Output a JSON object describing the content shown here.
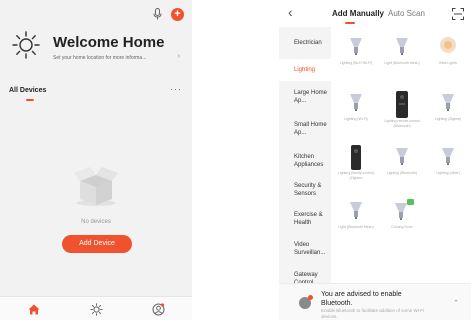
{
  "left": {
    "status_text": "",
    "welcome": {
      "title": "Welcome Home",
      "subtitle": "Set your home location for more informa...",
      "arrow": "›"
    },
    "devices": {
      "tab_label": "All Devices",
      "more": "···"
    },
    "empty": {
      "text": "No devices",
      "button": "Add Device"
    },
    "nav": [
      {
        "icon": "home-icon",
        "active": true
      },
      {
        "icon": "scene-icon",
        "active": false
      },
      {
        "icon": "profile-icon",
        "active": false
      }
    ],
    "accent_color": "#f0522d"
  },
  "right": {
    "back": "‹",
    "tabs": {
      "manual": "Add Manually",
      "scan": "Auto Scan"
    },
    "categories": [
      {
        "label": "Electrician",
        "active": false
      },
      {
        "label": "Lighting",
        "active": true
      },
      {
        "label": "Large Home Ap...",
        "active": false
      },
      {
        "label": "Small Home Ap...",
        "active": false
      },
      {
        "label": "Kitchen Appliances",
        "active": false
      },
      {
        "label": "Security & Sensors",
        "active": false
      },
      {
        "label": "Exercise & Health",
        "active": false
      },
      {
        "label": "Video Surveillan...",
        "active": false
      },
      {
        "label": "Gateway Control",
        "active": false
      }
    ],
    "products": [
      {
        "label": "Lighting (BLE+Wi-Fi)",
        "icon": "bulb-icon"
      },
      {
        "label": "Light (Bluetooth Mesh)",
        "icon": "bulb-icon"
      },
      {
        "label": "Beta Lights",
        "icon": "bulb-glow-icon"
      },
      {
        "label": "Lighting (Wi-Fi)",
        "icon": "bulb-icon"
      },
      {
        "label": "Lighting remote control (Bluetooth)",
        "icon": "remote-icon"
      },
      {
        "label": "Lighting (Zigbee)",
        "icon": "bulb-icon"
      },
      {
        "label": "Lighting (family control) (Zigbee)",
        "icon": "remote-icon"
      },
      {
        "label": "Lighting (Bluetooth)",
        "icon": "bulb-icon"
      },
      {
        "label": "Lighting (other)",
        "icon": "bulb-icon"
      },
      {
        "label": "Light (Bluetooth Mesh)",
        "icon": "bulb-icon"
      },
      {
        "label": "Coming Soon",
        "icon": "bulb-new-icon"
      }
    ],
    "bluetooth": {
      "title": "You are advised to enable Bluetooth.",
      "subtitle": "Enable Bluetooth to facilitate addition of some Wi-Fi devices.",
      "chevron": "⌃"
    }
  }
}
